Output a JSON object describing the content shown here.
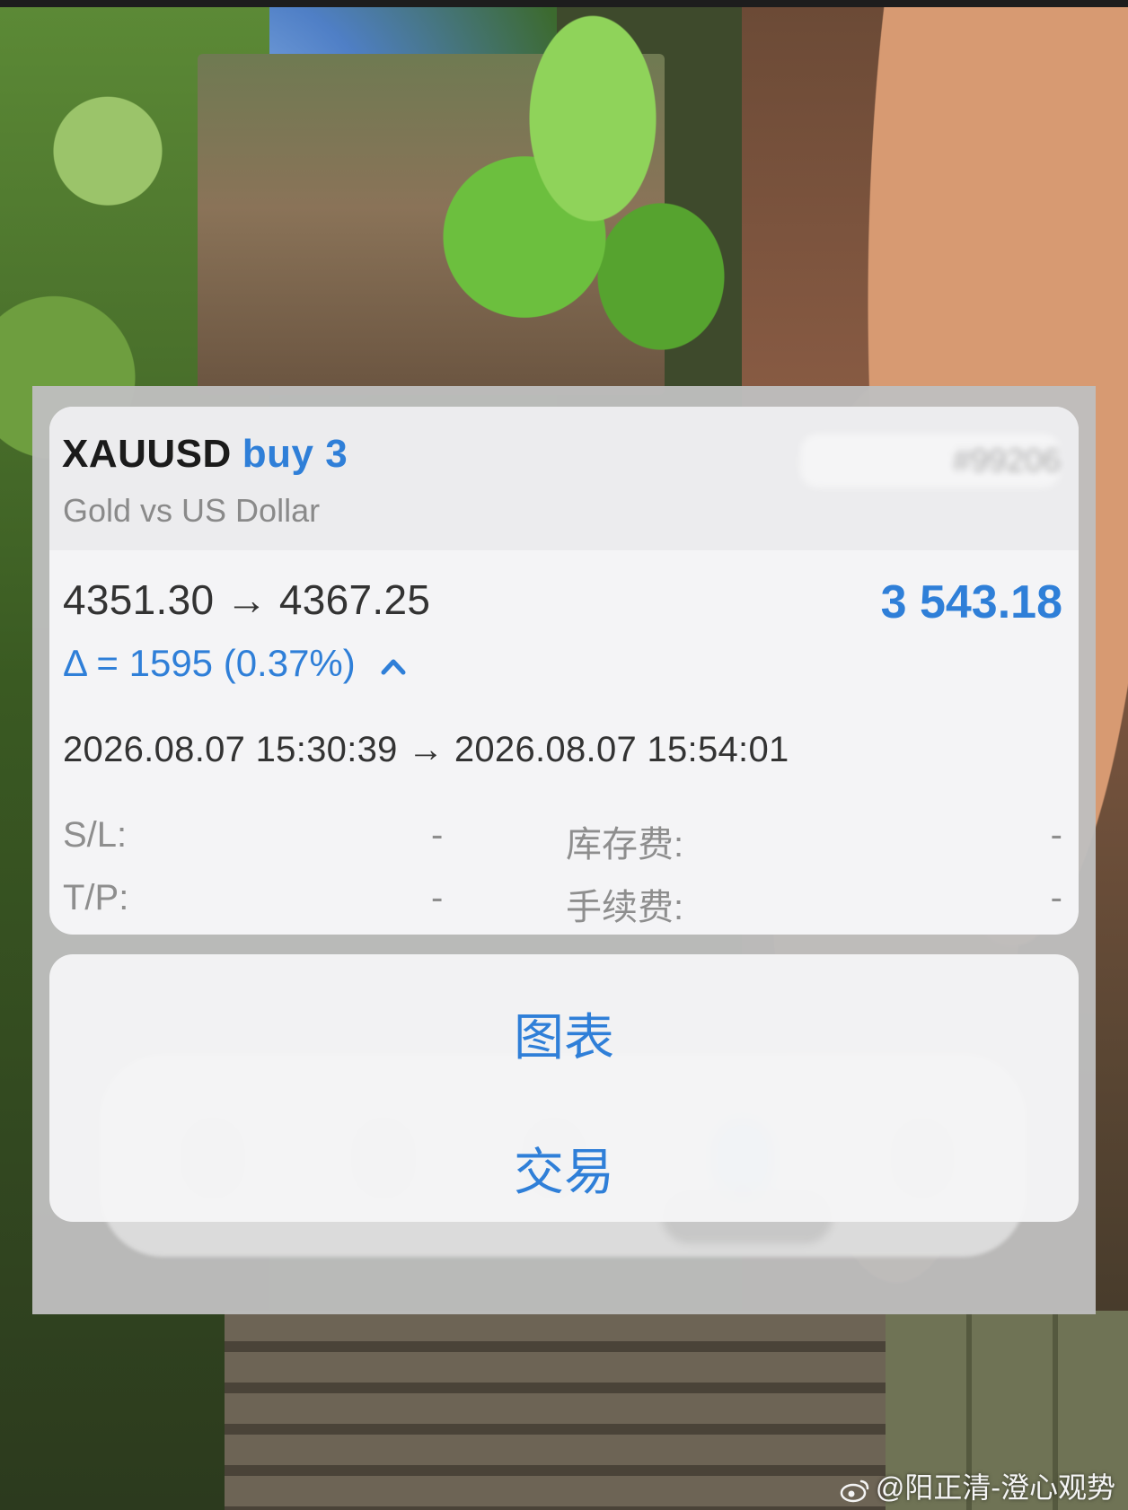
{
  "trade": {
    "symbol": "XAUUSD",
    "side": "buy 3",
    "description": "Gold vs US Dollar",
    "order_id": "#99206",
    "prices": "4351.30 → 4367.25",
    "profit": "3 543.18",
    "delta": "Δ = 1595 (0.37%)",
    "times": "2026.08.07 15:30:39 → 2026.08.07 15:54:01",
    "sl_label": "S/L:",
    "sl_value": "-",
    "tp_label": "T/P:",
    "tp_value": "-",
    "swap_label": "库存费:",
    "swap_value": "-",
    "commission_label": "手续费:",
    "commission_value": "-"
  },
  "actions": {
    "chart_label": "图表",
    "trade_label": "交易"
  },
  "watermark": "@阳正清-澄心观势",
  "colors": {
    "accent": "#2f7fd8",
    "card_bg": "#f4f4f6",
    "overlay": "#bebebe"
  },
  "icons": {
    "direction": "chevron-up-icon",
    "watermark_logo": "weibo-icon"
  }
}
